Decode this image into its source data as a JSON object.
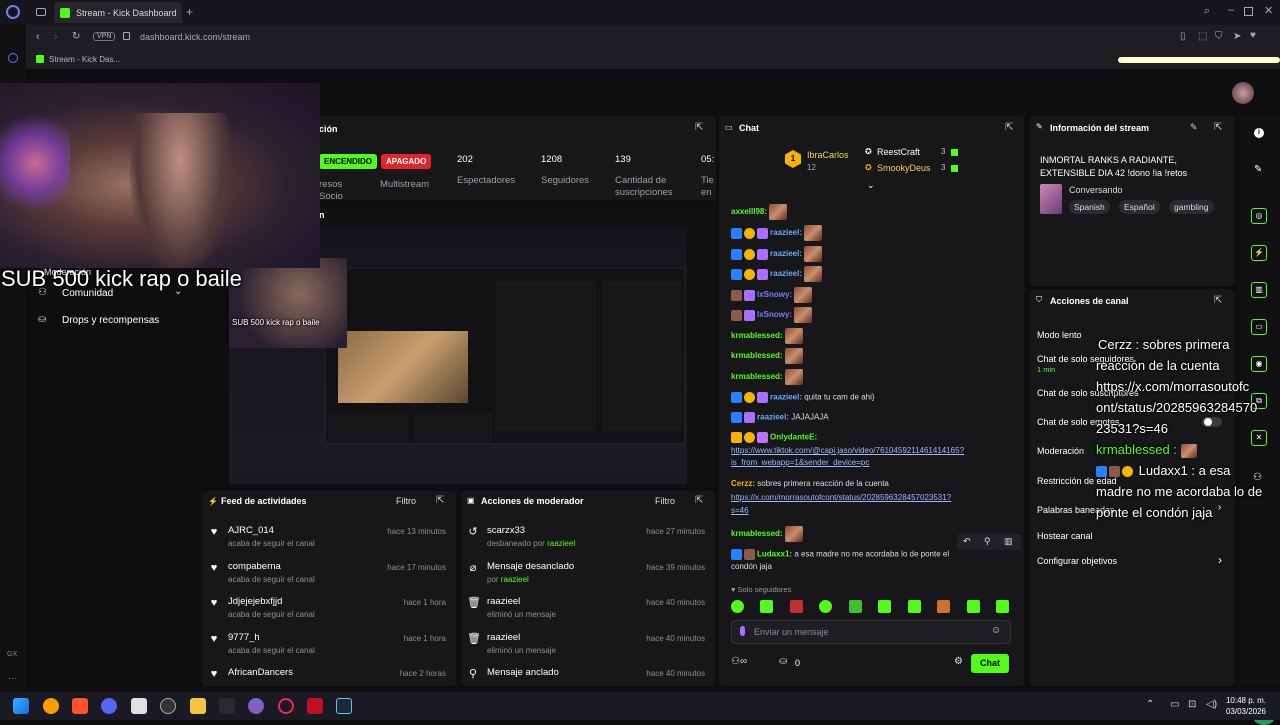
{
  "browser": {
    "tab_title": "Stream - Kick Dashboard",
    "url": "dashboard.kick.com/stream",
    "vpn": "VPN",
    "bookmark": "Stream - Kick Das..."
  },
  "webcam": {
    "overlay": "SUB 500 kick  rap o  baile",
    "mini_overlay": "SUB 500 kick  rap o  baile"
  },
  "sidebar": {
    "items": [
      {
        "label": "Moderación"
      },
      {
        "label": "Comunidad"
      },
      {
        "label": "Drops y recompensas"
      }
    ]
  },
  "stats": {
    "title": "ción",
    "status_live": "ENCENDIDO",
    "status_off": "APAGADO",
    "partner_label": "resos\nSocio",
    "multistream_label": "Multistream",
    "viewers": "202",
    "viewers_label": "Espectadores",
    "followers": "1208",
    "followers_label": "Seguidores",
    "subs": "139",
    "subs_label": "Cantidad de suscripciones",
    "uptime": "05:",
    "uptime_label": "Tie en",
    "preview_label": "n"
  },
  "activity": {
    "title": "Feed de actividades",
    "filter": "Filtro",
    "items": [
      {
        "name": "AJRC_014",
        "sub": "acaba de seguir el canal",
        "time": "hace 13 minutos"
      },
      {
        "name": "compaberna",
        "sub": "acaba de seguir el canal",
        "time": "hace 17 minutos"
      },
      {
        "name": "Jdjejejebxfjjd",
        "sub": "acaba de seguir el canal",
        "time": "hace 1 hora"
      },
      {
        "name": "9777_h",
        "sub": "acaba de seguir el canal",
        "time": "hace 1 hora"
      },
      {
        "name": "AfricanDancers",
        "sub": "",
        "time": "hace 2 horas"
      }
    ]
  },
  "modactions": {
    "title": "Acciones de moderador",
    "filter": "Filtro",
    "by": "por",
    "items": [
      {
        "name": "scarzx33",
        "sub": "desbaneado",
        "mod": "raazieel",
        "time": "hace 27 minutos"
      },
      {
        "name": "Mensaje desanclado",
        "sub": "",
        "mod": "raazieel",
        "time": "hace 39 minutos"
      },
      {
        "name": "raazieel",
        "sub": "eliminó un mensaje",
        "mod": "",
        "time": "hace 40 minutos"
      },
      {
        "name": "raazieel",
        "sub": "eliminó un mensaje",
        "mod": "",
        "time": "hace 40 minutos"
      },
      {
        "name": "Mensaje anclado",
        "sub": "",
        "mod": "",
        "time": "hace 40 minutos"
      }
    ]
  },
  "chat": {
    "title": "Chat",
    "leader1": {
      "name": "IbraCarlos",
      "count": "12"
    },
    "leader2": {
      "name": "ReestCraft",
      "count": "3"
    },
    "leader3": {
      "name": "SmookyDeus",
      "count": "3"
    },
    "messages": {
      "m1_user": "axxelll98:",
      "m2_user": "raazieel:",
      "m3_user": "raazieel:",
      "m4_user": "raazieel:",
      "m5_user": "lxSnowy:",
      "m6_user": "lxSnowy:",
      "m7_user": "krmablessed:",
      "m8_user": "krmablessed:",
      "m9_user": "krmablessed:",
      "m10_user": "raazieel:",
      "m10_text": "quita tu cam de ahi}",
      "m11_user": "raazieel:",
      "m11_text": "JAJAJAJA",
      "m12_user": "OnlydanteE:",
      "m12_link": "https://www.tiktok.com/@capi.jaso/video/7610459211461414165?",
      "m12_link2": "is_from_webapp=1&sender_device=pc",
      "m13_user": "Cerzz:",
      "m13_text": "sobres primera reacción de la cuenta",
      "m13_link": "https://x.com/morrasoutofcont/status/2028596328457023531?",
      "m13_link2": "s=46",
      "m14_user": "krmablessed:",
      "m15_user": "Ludaxx1:",
      "m15_text": "a esa madre no me acordaba lo de ponte el",
      "m15_text2": "condón jaja"
    },
    "followers_only": "Solo seguidores",
    "input_placeholder": "Enviar un mensaje",
    "points": "0",
    "send": "Chat"
  },
  "streaminfo": {
    "title": "Información del stream",
    "stream_title": "INMORTAL RANKS A RADIANTE, EXTENSIBLE DIA 42 !dono !ia !retos",
    "category": "Conversando",
    "tags": [
      "Spanish",
      "Español",
      "gambling"
    ]
  },
  "channel_actions": {
    "title": "Acciones de canal",
    "items": [
      {
        "label": "Modo lento"
      },
      {
        "label": "Chat de solo seguidores"
      },
      {
        "label": "Chat de solo suscriptores"
      },
      {
        "label": "Chat de solo emotes"
      },
      {
        "label": "Moderación"
      },
      {
        "label": "Restricción de edad"
      },
      {
        "label": "Palabras baneadas"
      },
      {
        "label": "Hostear canal"
      },
      {
        "label": "Configurar objetivos"
      }
    ],
    "followers_time": "1 min"
  },
  "alert_overlay": {
    "line1": "Cerzz : sobres primera",
    "line2": "reacción de la cuenta",
    "line3": "https://x.com/morrasoutofc",
    "line4": "ont/status/20285963284570",
    "line5": "23531?s=46",
    "line6": "krmablessed :",
    "line7": "Ludaxx1 : a esa",
    "line8": "madre no me acordaba lo de",
    "line9": "ponte el condón jaja"
  },
  "taskbar": {
    "time": "10:48 p. m.",
    "date": "03/03/2026"
  },
  "colors": {
    "brand": "#53fc18",
    "off": "#e0262b",
    "bg": "#0e0e10",
    "panel": "#17171a"
  }
}
